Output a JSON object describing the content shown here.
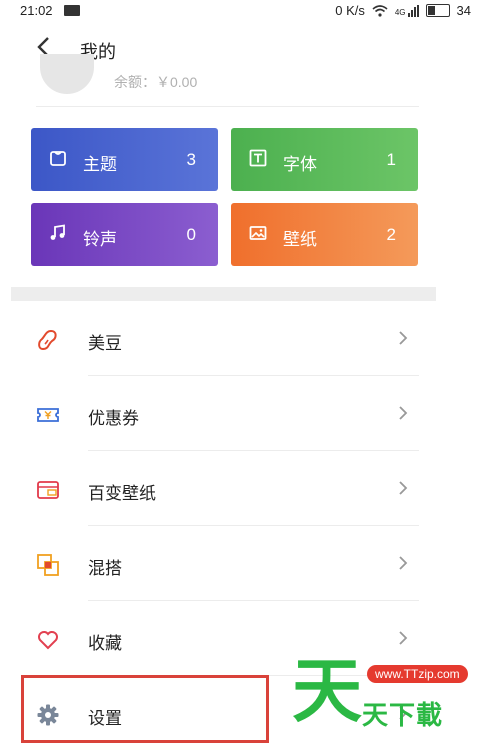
{
  "status_bar": {
    "time": "21:02",
    "network": "0 K/s",
    "signal": "4G",
    "battery": "34"
  },
  "header": {
    "title": "我的"
  },
  "profile": {
    "balance": "余额：￥0.00"
  },
  "tiles": [
    {
      "label": "主题",
      "count": "3",
      "icon": "theme-shirt-icon"
    },
    {
      "label": "字体",
      "count": "1",
      "icon": "font-t-icon"
    },
    {
      "label": "铃声",
      "count": "0",
      "icon": "music-note-icon"
    },
    {
      "label": "壁纸",
      "count": "2",
      "icon": "wallpaper-image-icon"
    }
  ],
  "menu": [
    {
      "label": "美豆",
      "icon": "bean-icon",
      "color": "#e24a2d"
    },
    {
      "label": "优惠券",
      "icon": "coupon-icon",
      "color": "#3b6fd8"
    },
    {
      "label": "百变壁纸",
      "icon": "wallpaper-card-icon",
      "color": "#e23a4a"
    },
    {
      "label": "混搭",
      "icon": "mix-squares-icon",
      "color": "#f0a020"
    },
    {
      "label": "收藏",
      "icon": "heart-icon",
      "color": "#e24050"
    },
    {
      "label": "设置",
      "icon": "gear-icon",
      "color": "#7a8799"
    }
  ],
  "watermark": {
    "char": "天",
    "site": "www.TTzip.com",
    "text": "天下載"
  }
}
